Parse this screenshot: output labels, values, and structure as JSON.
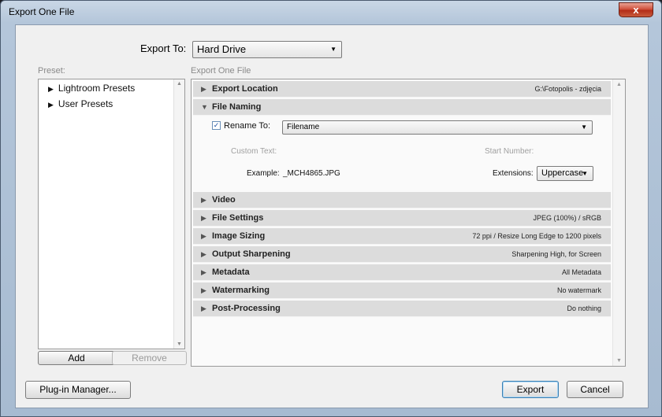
{
  "window": {
    "title": "Export One File",
    "close_symbol": "x"
  },
  "export_to": {
    "label": "Export To:",
    "value": "Hard Drive"
  },
  "preset": {
    "label": "Preset:",
    "items": [
      {
        "label": "Lightroom Presets"
      },
      {
        "label": "User Presets"
      }
    ],
    "add_label": "Add",
    "remove_label": "Remove"
  },
  "main": {
    "header": "Export One File",
    "sections": [
      {
        "name": "Export Location",
        "summary": "G:\\Fotopolis - zdjęcia",
        "expanded": false
      },
      {
        "name": "File Naming",
        "summary": "",
        "expanded": true
      },
      {
        "name": "Video",
        "summary": "",
        "expanded": false
      },
      {
        "name": "File Settings",
        "summary": "JPEG (100%) / sRGB",
        "expanded": false
      },
      {
        "name": "Image Sizing",
        "summary": "72 ppi / Resize Long Edge to 1200 pixels",
        "expanded": false
      },
      {
        "name": "Output Sharpening",
        "summary": "Sharpening High, for Screen",
        "expanded": false
      },
      {
        "name": "Metadata",
        "summary": "All Metadata",
        "expanded": false
      },
      {
        "name": "Watermarking",
        "summary": "No watermark",
        "expanded": false
      },
      {
        "name": "Post-Processing",
        "summary": "Do nothing",
        "expanded": false
      }
    ],
    "file_naming": {
      "rename_checked": true,
      "rename_label": "Rename To:",
      "rename_value": "Filename",
      "custom_text_label": "Custom Text:",
      "start_number_label": "Start Number:",
      "example_label": "Example:",
      "example_value": "_MCH4865.JPG",
      "extensions_label": "Extensions:",
      "extensions_value": "Uppercase"
    }
  },
  "footer": {
    "plugin_manager_label": "Plug-in Manager...",
    "export_label": "Export",
    "cancel_label": "Cancel"
  },
  "icons": {
    "expanded": "▼",
    "collapsed": "▶",
    "check": "✓",
    "dropdown": "▼"
  }
}
